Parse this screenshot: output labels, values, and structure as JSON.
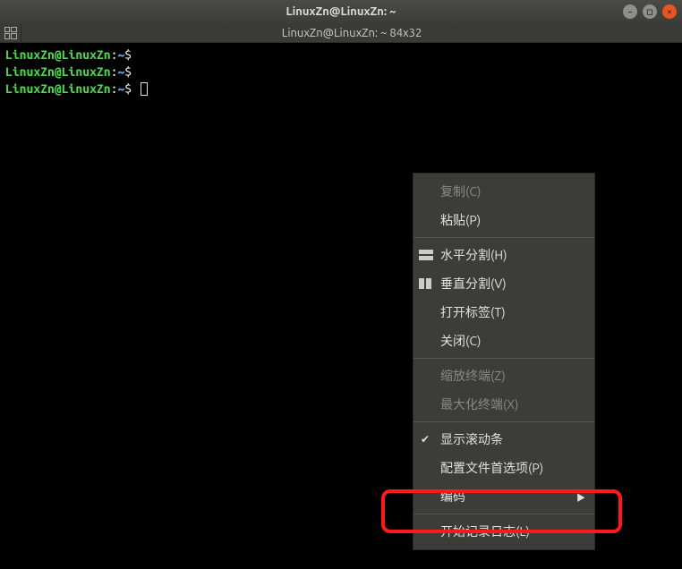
{
  "titlebar": {
    "title": "LinuxZn@LinuxZn: ~"
  },
  "subbar": {
    "text": "LinuxZn@LinuxZn: ~ 84x32"
  },
  "prompt": {
    "user_host": "LinuxZn@LinuxZn",
    "sep": ":",
    "path": "~",
    "symbol": "$"
  },
  "menu": {
    "copy": "复制(C)",
    "paste": "粘贴(P)",
    "hsplit": "水平分割(H)",
    "vsplit": "垂直分割(V)",
    "open_tab": "打开标签(T)",
    "close": "关闭(C)",
    "zoom": "缩放终端(Z)",
    "maximize": "最大化终端(X)",
    "scrollbar": "显示滚动条",
    "profile": "配置文件首选项(P)",
    "encoding": "编码",
    "start_log": "开始记录日志(L)"
  }
}
